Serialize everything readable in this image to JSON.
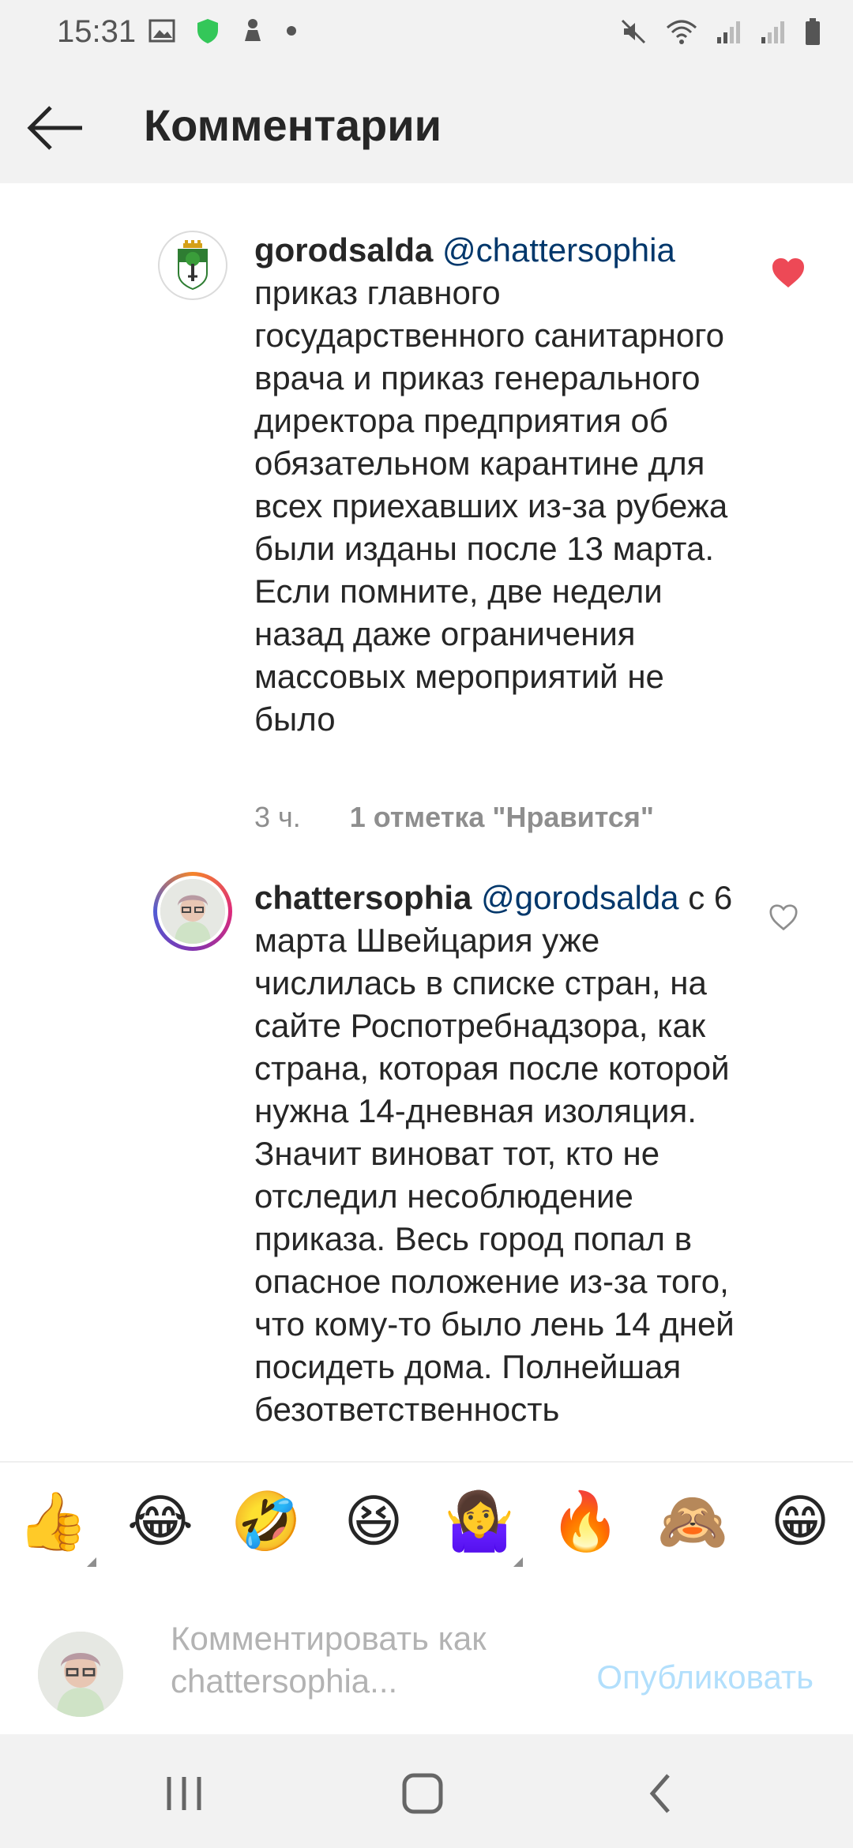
{
  "status_bar": {
    "time": "15:31",
    "left_icons": [
      "image-icon",
      "shield-icon",
      "app-notification-icon",
      "dot-icon"
    ],
    "right_icons": [
      "mute-icon",
      "wifi-icon",
      "signal-icon",
      "signal-icon",
      "battery-icon"
    ]
  },
  "header": {
    "back_icon": "arrow-left-icon",
    "title": "Комментарии"
  },
  "comments": [
    {
      "username": "gorodsalda",
      "mention": "@chattersophia",
      "text": "приказ главного государственного санитарного врача и приказ генерального директора предприятия об обязательном карантине для всех приехавших из-за рубежа были изданы после 13 марта. Если помните, две недели назад даже ограничения массовых мероприятий не было",
      "time": "3 ч.",
      "likes": "1 отметка \"Нравится\"",
      "liked": true
    },
    {
      "username": "chattersophia",
      "mention": "@gorodsalda",
      "text": "с 6 марта Швейцария уже числилась в списке стран, на сайте Роспотребнадзора, как страна, которая после которой нужна 14-дневная изоляция. Значит виноват тот, кто не отследил несоблюдение приказа. Весь город попал в опасное положение из-за того, что кому-то было лень 14 дней посидеть дома. Полнейшая безответственность",
      "liked": false
    }
  ],
  "emoji_bar": [
    "👍",
    "😂",
    "🤣",
    "😆",
    "🤷‍♀️",
    "🔥",
    "🙈",
    "😁"
  ],
  "compose": {
    "placeholder": "Комментировать как chattersophia...",
    "publish_label": "Опубликовать"
  },
  "nav": [
    "recent-apps-icon",
    "home-icon",
    "back-icon"
  ],
  "colors": {
    "heart_liked": "#ed4956",
    "mention": "#00376b",
    "publish_disabled": "#b2dffc",
    "meta_gray": "#8e8e8e"
  }
}
